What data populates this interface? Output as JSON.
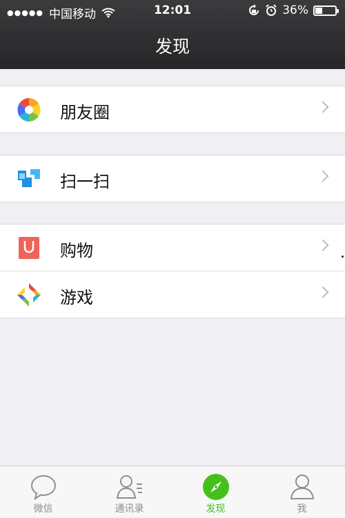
{
  "status_bar": {
    "signal": "●●●●●",
    "carrier": "中国移动",
    "time": "12:01",
    "battery_text": "36%",
    "battery_level": 0.36
  },
  "header": {
    "title": "发现"
  },
  "menu": {
    "groups": [
      [
        {
          "label": "朋友圈",
          "icon": "moments-icon"
        }
      ],
      [
        {
          "label": "扫一扫",
          "icon": "scan-icon"
        }
      ],
      [
        {
          "label": "购物",
          "icon": "shopping-bag-icon"
        },
        {
          "label": "游戏",
          "icon": "games-icon"
        }
      ]
    ]
  },
  "tabbar": {
    "active": "发现",
    "accent_color": "#45c01a",
    "items": [
      {
        "label": "微信",
        "icon": "chat-bubble-icon"
      },
      {
        "label": "通讯录",
        "icon": "contacts-icon"
      },
      {
        "label": "发现",
        "icon": "compass-icon"
      },
      {
        "label": "我",
        "icon": "profile-icon"
      }
    ]
  }
}
